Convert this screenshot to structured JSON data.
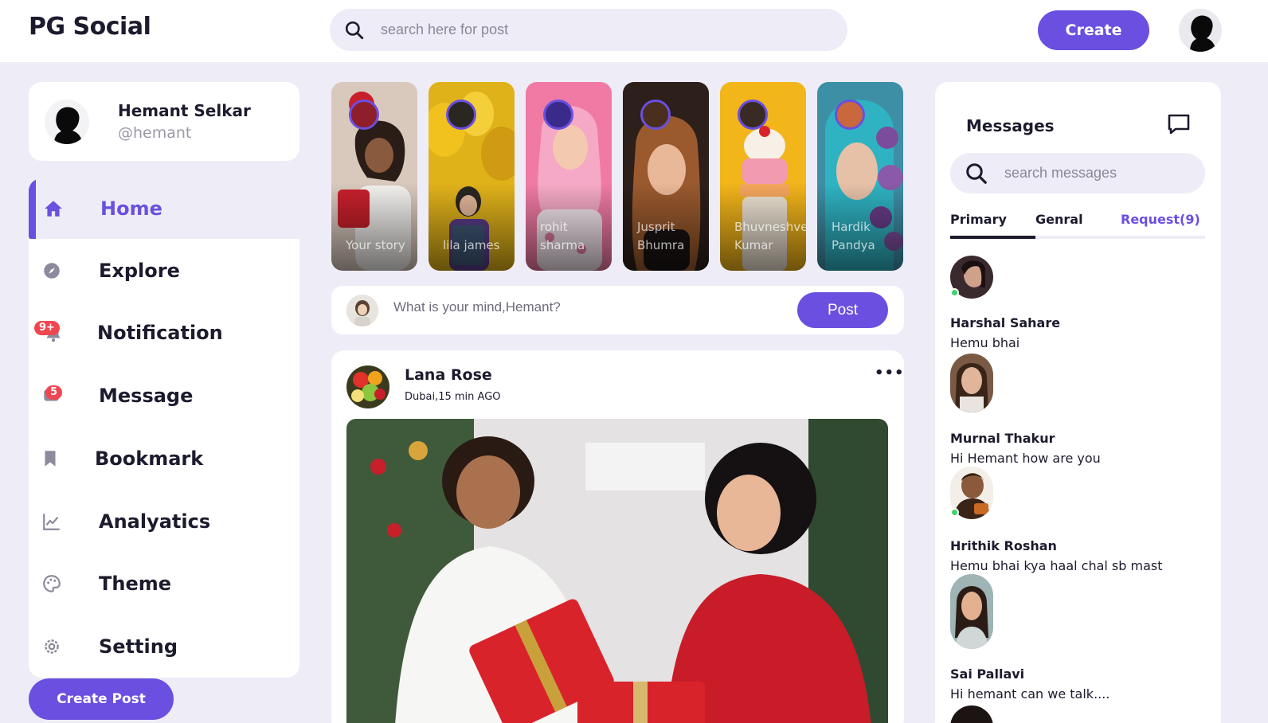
{
  "app": {
    "title": "PG Social"
  },
  "header": {
    "search_placeholder": "search here for post",
    "create_label": "Create"
  },
  "profile": {
    "name": "Hemant Selkar",
    "handle": "@hemant"
  },
  "sidebar": {
    "items": [
      {
        "label": "Home",
        "icon": "home-icon",
        "active": true
      },
      {
        "label": "Explore",
        "icon": "compass-icon"
      },
      {
        "label": "Notification",
        "icon": "bell-icon",
        "badge": "9+"
      },
      {
        "label": "Message",
        "icon": "chat-icon",
        "badge": "5"
      },
      {
        "label": "Bookmark",
        "icon": "bookmark-icon"
      },
      {
        "label": "Analyatics",
        "icon": "chart-icon"
      },
      {
        "label": "Theme",
        "icon": "palette-icon"
      },
      {
        "label": "Setting",
        "icon": "gear-icon"
      }
    ],
    "create_post_label": "Create Post"
  },
  "stories": [
    {
      "name": "Your story",
      "bg": "#d9c9bd",
      "accent": "#c8202b"
    },
    {
      "name": "lila james",
      "bg": "#e0b21a",
      "accent": "#2a2622"
    },
    {
      "name": "rohit sharma",
      "bg": "#f07aa3",
      "accent": "#f6c2d6"
    },
    {
      "name": "Jusprit Bhumra",
      "bg": "#2d1f1a",
      "accent": "#b5744a"
    },
    {
      "name": "Bhuvneshver Kumar",
      "bg": "#f2b51a",
      "accent": "#f5ede0"
    },
    {
      "name": "Hardik Pandya",
      "bg": "#3d8fa6",
      "accent": "#7b4c9c"
    }
  ],
  "composer": {
    "placeholder": "What is your mind,Hemant?",
    "post_label": "Post"
  },
  "feed": {
    "author": "Lana Rose",
    "meta": "Dubai,15 min AGO",
    "more": "•••"
  },
  "messages": {
    "title": "Messages",
    "search_placeholder": "search messages",
    "tabs": [
      "Primary",
      "Genral",
      "Request(9)"
    ],
    "items": [
      {
        "name": "Harshal Sahare",
        "text": "Hemu bhai",
        "online": true,
        "avatar_bg": "#3a2a2e"
      },
      {
        "name": "Murnal Thakur",
        "text": "Hi Hemant how are you",
        "online": false,
        "avatar_bg": "#7a5a44"
      },
      {
        "name": "Hrithik Roshan",
        "text": "Hemu bhai kya haal chal sb mast",
        "online": true,
        "avatar_bg": "#4a3524"
      },
      {
        "name": "Sai Pallavi",
        "text": "Hi hemant can we talk....",
        "online": false,
        "avatar_bg": "#7f9aa0"
      }
    ]
  },
  "colors": {
    "accent": "#6a4fe0",
    "background": "#eeecf6",
    "badge": "#ef4650",
    "online": "#3fd46b"
  }
}
